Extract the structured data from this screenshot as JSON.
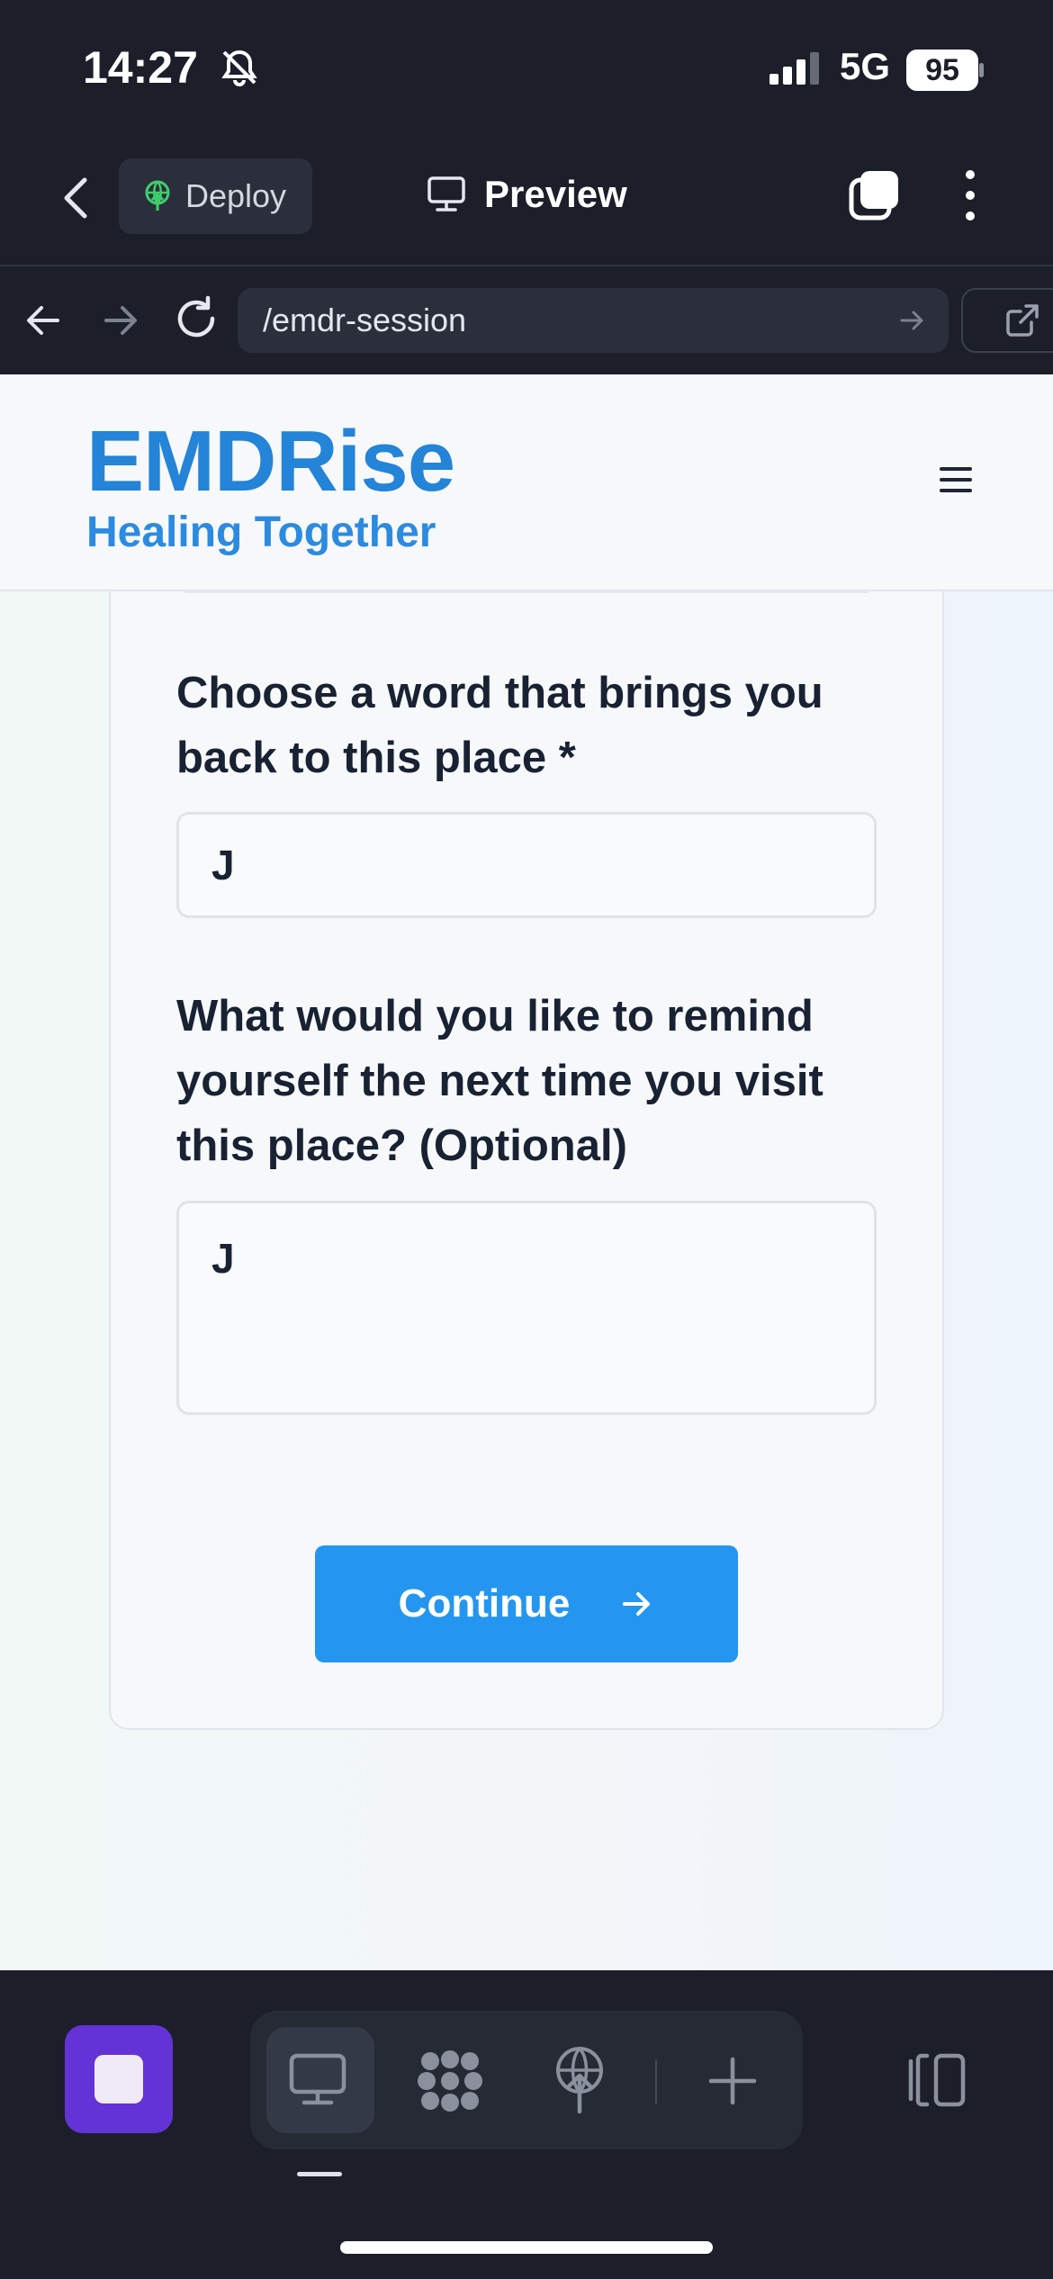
{
  "status_bar": {
    "time": "14:27",
    "network": "5G",
    "battery": "95"
  },
  "toolbar": {
    "deploy_label": "Deploy",
    "preview_label": "Preview"
  },
  "url_bar": {
    "path": "/emdr-session"
  },
  "app": {
    "brand": "EMDRise",
    "tagline": "Healing Together",
    "form": {
      "question_word": "Choose a word that brings you back to this place *",
      "answer_word": "J",
      "question_reminder": "What would you like to remind yourself the next time you visit this place? (Optional)",
      "answer_reminder": "J",
      "continue_label": "Continue"
    }
  },
  "colors": {
    "brand_blue": "#2384d8",
    "button_blue": "#2596f0",
    "stop_purple": "#6433d6",
    "chrome_dark": "#1c1f2a"
  },
  "icons": [
    "bell-slash-icon",
    "signal-icon",
    "back-chevron-icon",
    "deploy-icon",
    "monitor-icon",
    "tabs-icon",
    "more-vertical-icon",
    "arrow-left-icon",
    "arrow-right-icon",
    "reload-icon",
    "external-link-icon",
    "hamburger-menu-icon",
    "stop-icon",
    "dots-grid-icon",
    "plus-icon",
    "panels-icon"
  ]
}
